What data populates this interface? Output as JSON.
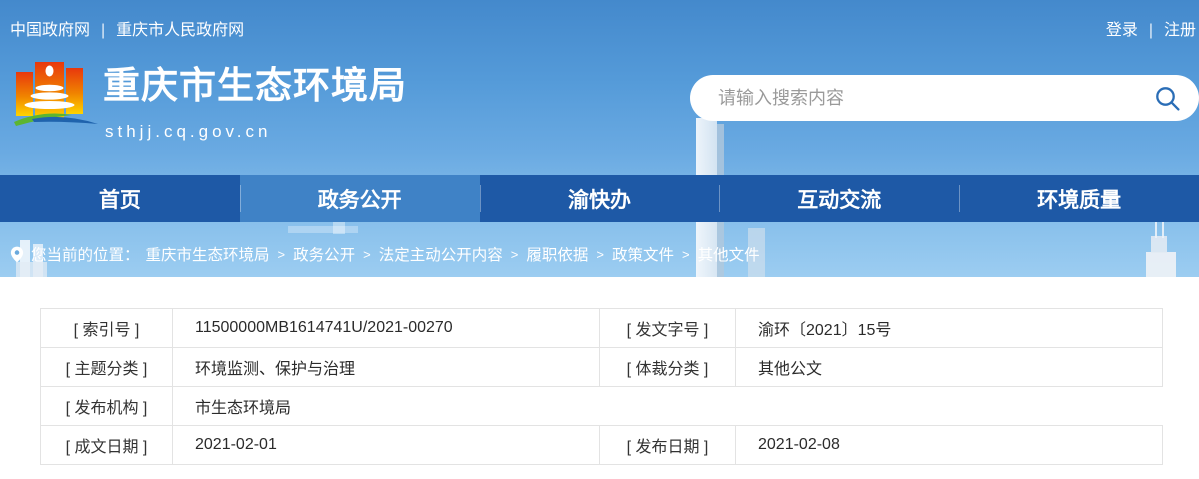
{
  "topbar": {
    "links": [
      "中国政府网",
      "重庆市人民政府网"
    ],
    "separator": "|",
    "login_label": "登录",
    "register_label": "注册"
  },
  "header": {
    "site_name": "重庆市生态环境局",
    "site_domain": "sthjj.cq.gov.cn",
    "search_placeholder": "请输入搜索内容"
  },
  "nav": {
    "items": [
      {
        "key": "home",
        "label": "首页",
        "active": false
      },
      {
        "key": "gov-info",
        "label": "政务公开",
        "active": true
      },
      {
        "key": "yukuaiban",
        "label": "渝快办",
        "active": false
      },
      {
        "key": "interaction",
        "label": "互动交流",
        "active": false
      },
      {
        "key": "env-quality",
        "label": "环境质量",
        "active": false
      }
    ]
  },
  "breadcrumb": {
    "prefix": "您当前的位置：",
    "separator": ">",
    "items": [
      "重庆市生态环境局",
      "政务公开",
      "法定主动公开内容",
      "履职依据",
      "政策文件",
      "其他文件"
    ]
  },
  "document_info": {
    "rows": [
      [
        {
          "label": "[ 索引号 ]",
          "value": "11500000MB1614741U/2021-00270"
        },
        {
          "label": "[ 发文字号 ]",
          "value": "渝环〔2021〕15号"
        }
      ],
      [
        {
          "label": "[ 主题分类 ]",
          "value": "环境监测、保护与治理"
        },
        {
          "label": "[ 体裁分类 ]",
          "value": "其他公文"
        }
      ],
      [
        {
          "label": "[ 发布机构 ]",
          "value": "市生态环境局"
        },
        {
          "label": "",
          "value": "",
          "empty": true
        }
      ],
      [
        {
          "label": "[ 成文日期 ]",
          "value": "2021-02-01"
        },
        {
          "label": "[ 发布日期 ]",
          "value": "2021-02-08"
        }
      ]
    ]
  },
  "icons": {
    "logo": "chongqing-hall-logo",
    "search": "magnifier",
    "breadcrumb_pin": "location-pin"
  },
  "colors": {
    "sky_top": "#4489cc",
    "sky_bottom": "#9ccdf1",
    "nav_bg": "#1e59a6",
    "nav_active": "#3f82c6",
    "search_icon": "#2a6db6",
    "table_border": "#e3e3e3",
    "logo_red": "#e8380d",
    "logo_orange": "#f08300",
    "logo_yellow": "#ffd400",
    "logo_green": "#5cb531",
    "logo_blue": "#1f63ad"
  }
}
